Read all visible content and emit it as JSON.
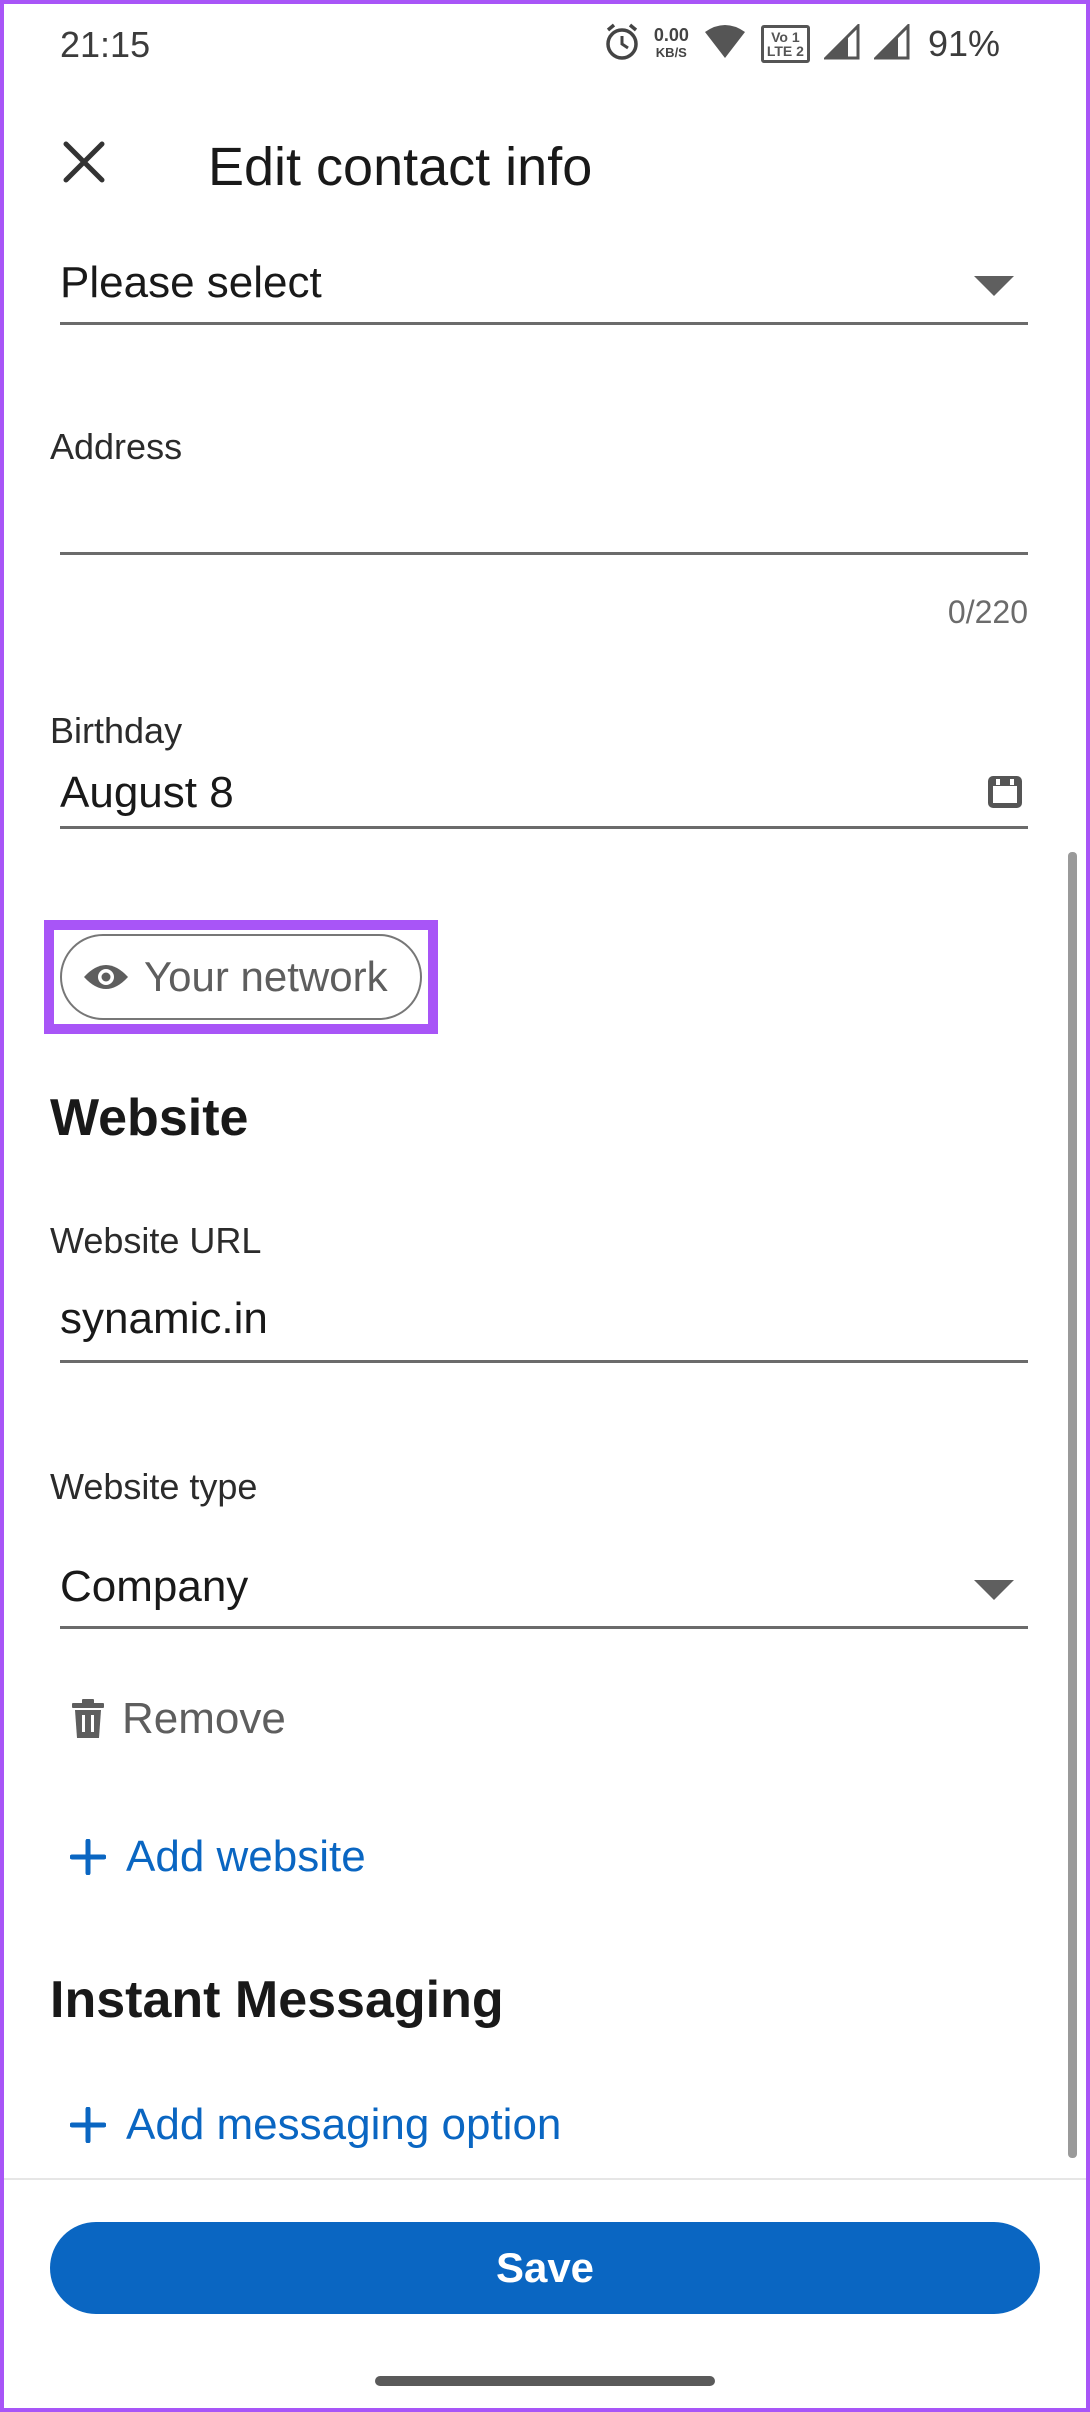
{
  "status_bar": {
    "time": "21:15",
    "speed_value": "0.00",
    "speed_unit": "KB/S",
    "volte_line1": "Vo 1",
    "volte_line2": "LTE 2",
    "battery": "91%",
    "icons": [
      "alarm-icon",
      "wifi-icon",
      "volte-icon",
      "signal-icon",
      "signal-icon"
    ]
  },
  "header": {
    "title": "Edit contact info",
    "close_icon": "close-icon"
  },
  "fields": {
    "top_select": {
      "value": "Please select"
    },
    "address": {
      "label": "Address",
      "value": "",
      "counter": "0/220"
    },
    "birthday": {
      "label": "Birthday",
      "value": "August 8"
    }
  },
  "visibility": {
    "label": "Your network",
    "icon": "eye-icon"
  },
  "website": {
    "section_title": "Website",
    "url_label": "Website URL",
    "url_value": "synamic.in",
    "type_label": "Website type",
    "type_value": "Company",
    "remove_label": "Remove",
    "add_label": "Add website"
  },
  "instant_messaging": {
    "section_title": "Instant Messaging",
    "add_label": "Add messaging option"
  },
  "footer": {
    "save_label": "Save"
  },
  "colors": {
    "accent": "#0a66c2",
    "highlight": "#a855f7",
    "text": "#191919",
    "muted": "#5e5e5e"
  }
}
